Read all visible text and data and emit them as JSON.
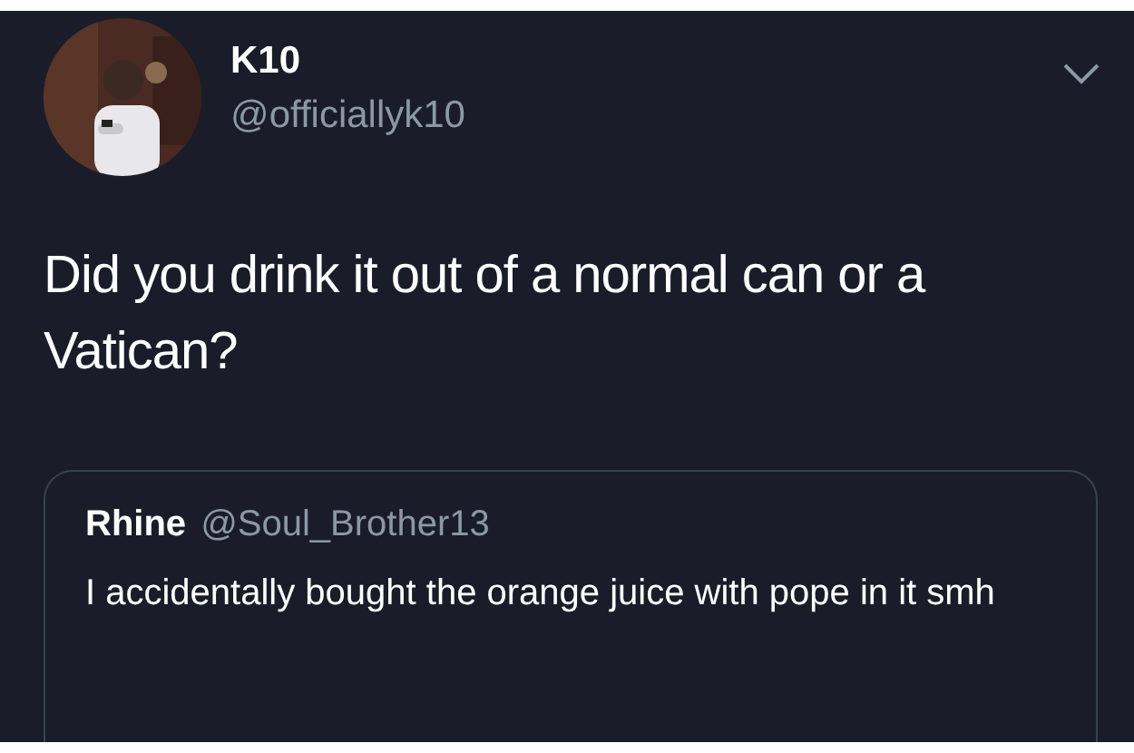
{
  "author": {
    "name": "K10",
    "handle": "@officiallyk10"
  },
  "text": "Did you drink it out of a normal can or a Vatican?",
  "quoted": {
    "name": "Rhine",
    "handle": "@Soul_Brother13",
    "text": "I accidentally bought the orange juice with pope in it smh"
  }
}
